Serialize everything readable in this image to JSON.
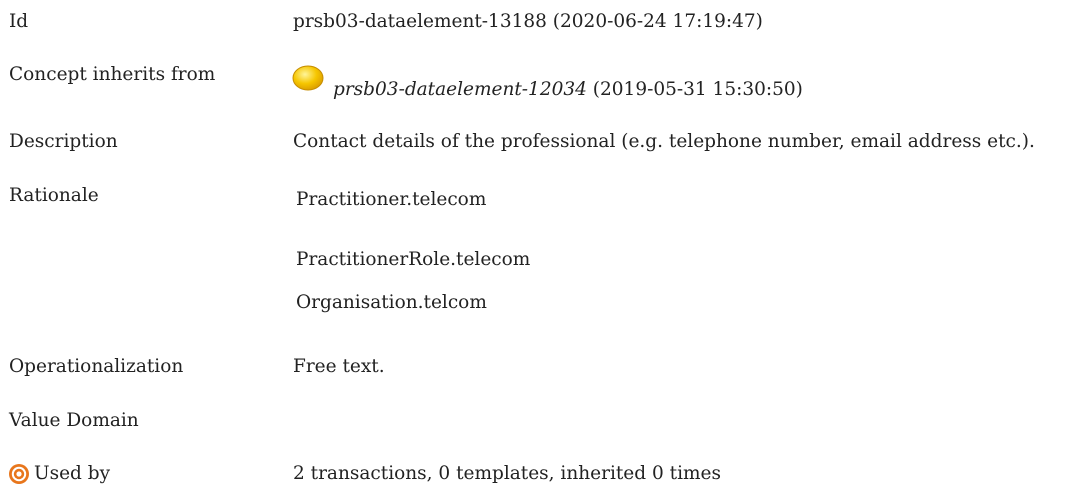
{
  "rows": {
    "id": {
      "label": "Id",
      "value": "prsb03-dataelement-13188 (2020-06-24 17:19:47)"
    },
    "inherits": {
      "label": "Concept inherits from",
      "link": "prsb03-dataelement-12034",
      "timestamp": "(2019-05-31 15:30:50)"
    },
    "description": {
      "label": "Description",
      "value": "Contact details of the professional (e.g. telephone number, email address etc.)."
    },
    "rationale": {
      "label": "Rationale",
      "lines": [
        "Practitioner.telecom",
        "PractitionerRole.telecom",
        "Organisation.telcom"
      ]
    },
    "operationalization": {
      "label": "Operationalization",
      "value": "Free text."
    },
    "value_domain": {
      "label": "Value Domain"
    },
    "used_by": {
      "label": "Used by",
      "value": "2 transactions, 0 templates, inherited 0 times"
    }
  },
  "icons": {
    "inherits": "sun-icon",
    "used_by": "target-icon"
  },
  "colors": {
    "text": "#222222",
    "sun": "#f5c400",
    "target": "#e8761c"
  }
}
